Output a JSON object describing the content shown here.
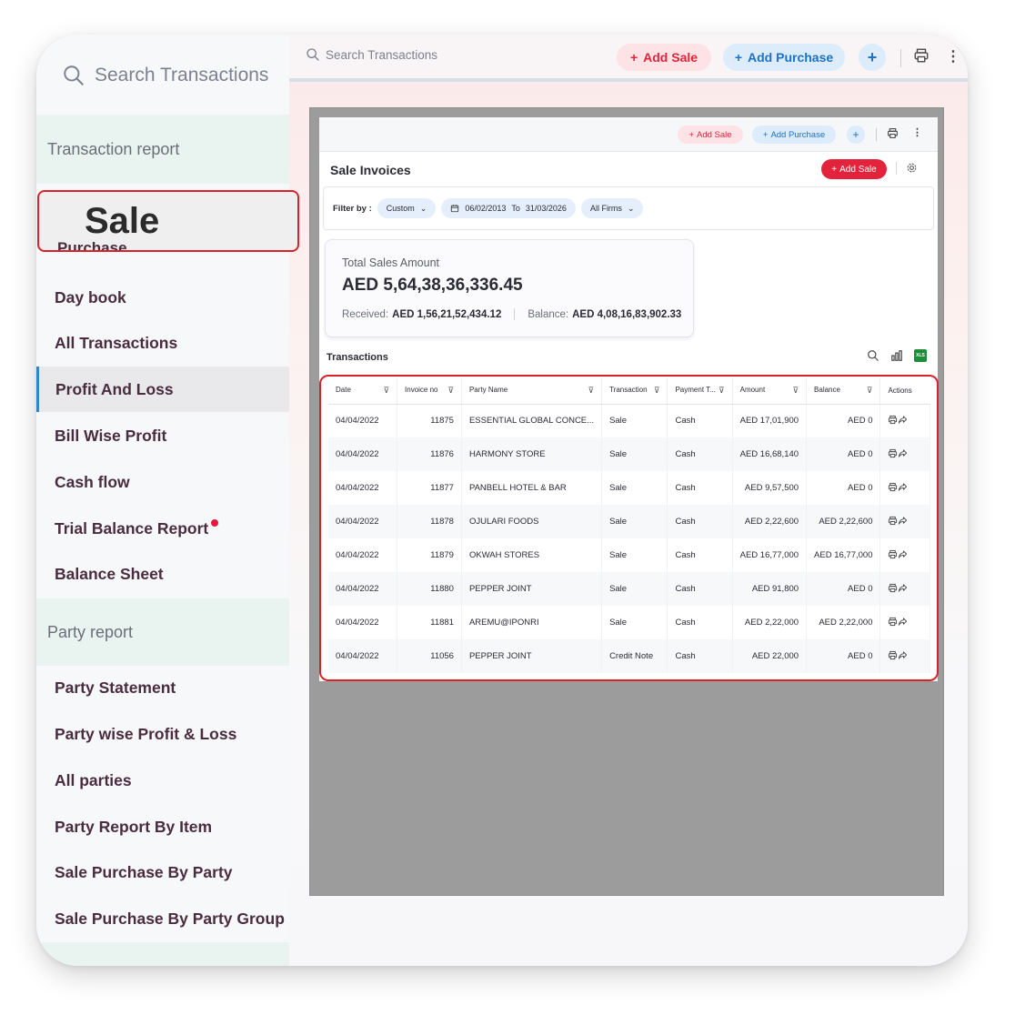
{
  "sidebar": {
    "search_placeholder": "Search Transactions",
    "section_transaction": "Transaction report",
    "highlight_label": "Sale",
    "partially_hidden_item": "Purchase",
    "transaction_items": [
      "Day book",
      "All Transactions",
      "Profit And Loss",
      "Bill Wise Profit",
      "Cash flow",
      "Trial Balance Report",
      "Balance Sheet"
    ],
    "active_item": "Profit And Loss",
    "section_party": "Party report",
    "party_items": [
      "Party Statement",
      "Party wise Profit & Loss",
      "All parties",
      "Party Report By Item",
      "Sale Purchase By Party",
      "Sale Purchase By Party Group"
    ]
  },
  "topbar": {
    "search_placeholder": "Search Transactions",
    "add_sale": "Add Sale",
    "add_purchase": "Add Purchase",
    "plus": "+"
  },
  "inner": {
    "top_add_sale": "Add Sale",
    "top_add_purchase": "Add Purchase",
    "title": "Sale Invoices",
    "add_sale_button": "Add Sale",
    "filter": {
      "label": "Filter by :",
      "period": "Custom",
      "from": "06/02/2013",
      "to_label": "To",
      "to": "31/03/2026",
      "firms": "All Firms"
    },
    "total": {
      "label": "Total Sales Amount",
      "amount": "AED 5,64,38,36,336.45",
      "received_label": "Received:",
      "received": "AED 1,56,21,52,434.12",
      "balance_label": "Balance:",
      "balance": "AED 4,08,16,83,902.33"
    },
    "transactions_heading": "Transactions",
    "xls_label": "XLS",
    "columns": [
      "Date",
      "Invoice no",
      "Party Name",
      "Transaction",
      "Payment T...",
      "Amount",
      "Balance",
      "Actions"
    ],
    "rows": [
      {
        "date": "04/04/2022",
        "invoice": "11875",
        "party": "ESSENTIAL GLOBAL CONCE...",
        "type": "Sale",
        "payment": "Cash",
        "amount": "AED 17,01,900",
        "balance": "AED 0"
      },
      {
        "date": "04/04/2022",
        "invoice": "11876",
        "party": "HARMONY STORE",
        "type": "Sale",
        "payment": "Cash",
        "amount": "AED 16,68,140",
        "balance": "AED 0"
      },
      {
        "date": "04/04/2022",
        "invoice": "11877",
        "party": "PANBELL HOTEL & BAR",
        "type": "Sale",
        "payment": "Cash",
        "amount": "AED 9,57,500",
        "balance": "AED 0"
      },
      {
        "date": "04/04/2022",
        "invoice": "11878",
        "party": "OJULARI FOODS",
        "type": "Sale",
        "payment": "Cash",
        "amount": "AED 2,22,600",
        "balance": "AED 2,22,600"
      },
      {
        "date": "04/04/2022",
        "invoice": "11879",
        "party": "OKWAH STORES",
        "type": "Sale",
        "payment": "Cash",
        "amount": "AED 16,77,000",
        "balance": "AED 16,77,000"
      },
      {
        "date": "04/04/2022",
        "invoice": "11880",
        "party": "PEPPER JOINT",
        "type": "Sale",
        "payment": "Cash",
        "amount": "AED 91,800",
        "balance": "AED 0"
      },
      {
        "date": "04/04/2022",
        "invoice": "11881",
        "party": "AREMU@IPONRI",
        "type": "Sale",
        "payment": "Cash",
        "amount": "AED 2,22,000",
        "balance": "AED 2,22,000"
      },
      {
        "date": "04/04/2022",
        "invoice": "11056",
        "party": "PEPPER JOINT",
        "type": "Credit Note",
        "payment": "Cash",
        "amount": "AED 22,000",
        "balance": "AED 0"
      }
    ]
  },
  "colors": {
    "accent_red": "#e3233b",
    "accent_blue": "#1c72c4",
    "highlight_border": "#d8232a",
    "active_bar": "#2d86c7",
    "item_text": "#4a2c3f"
  }
}
